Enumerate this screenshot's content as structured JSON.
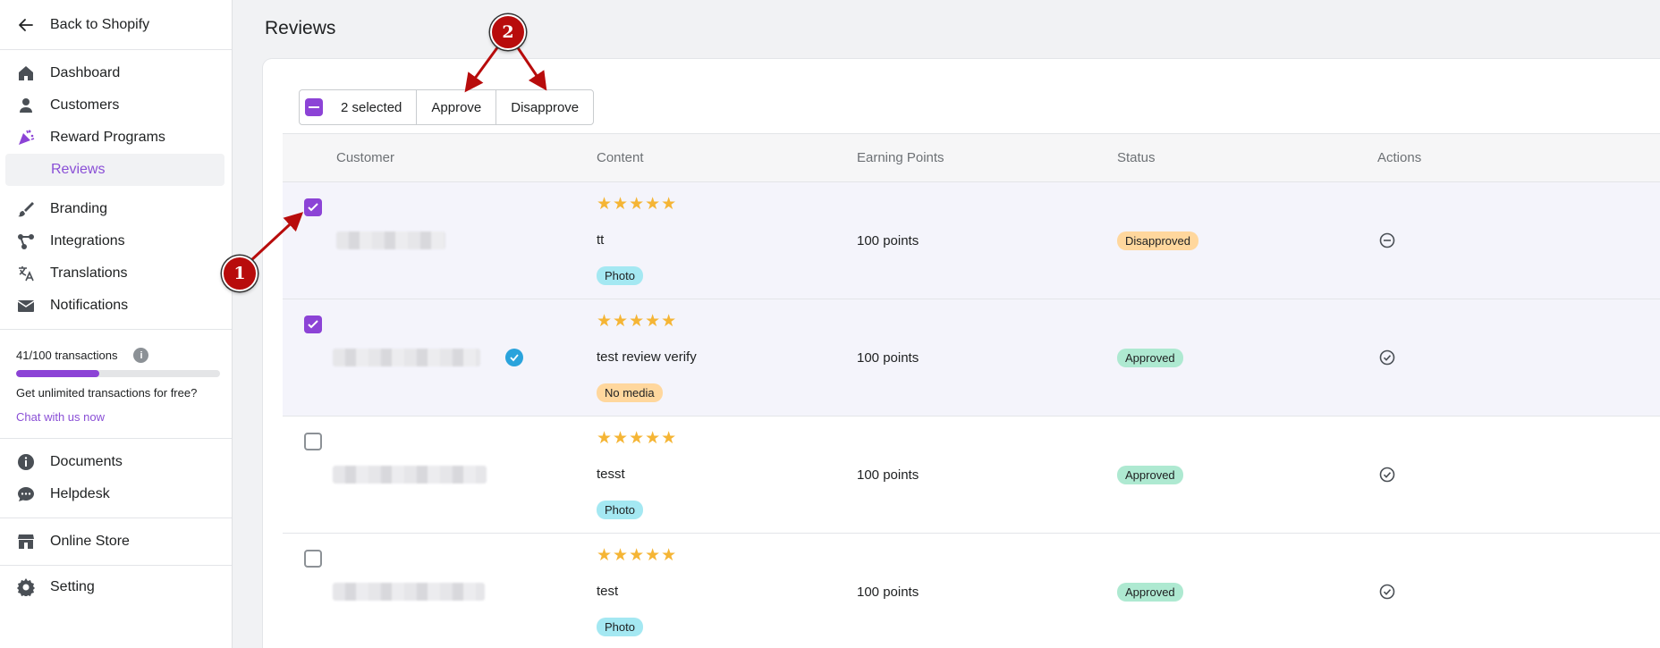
{
  "sidebar": {
    "back_label": "Back to Shopify",
    "nav": [
      {
        "label": "Dashboard",
        "icon": "home-icon"
      },
      {
        "label": "Customers",
        "icon": "user-icon"
      },
      {
        "label": "Reward Programs",
        "icon": "party-popper-icon"
      }
    ],
    "sub_nav": {
      "label": "Reviews"
    },
    "nav2": [
      {
        "label": "Branding",
        "icon": "brush-icon"
      },
      {
        "label": "Integrations",
        "icon": "integration-icon"
      },
      {
        "label": "Translations",
        "icon": "translate-icon"
      },
      {
        "label": "Notifications",
        "icon": "mail-icon"
      }
    ],
    "usage": {
      "label": "41/100 transactions",
      "used": 41,
      "limit": 100,
      "upsell": "Get unlimited transactions for free?",
      "link": "Chat with us now"
    },
    "help": [
      {
        "label": "Documents",
        "icon": "info-icon"
      },
      {
        "label": "Helpdesk",
        "icon": "chat-icon"
      }
    ],
    "store": {
      "label": "Online Store",
      "icon": "store-icon"
    },
    "setting": {
      "label": "Setting",
      "icon": "gear-icon"
    }
  },
  "page": {
    "title": "Reviews"
  },
  "bulk": {
    "selected_label": "2 selected",
    "approve_label": "Approve",
    "disapprove_label": "Disapprove"
  },
  "table": {
    "headers": [
      "Customer",
      "Content",
      "Earning Points",
      "Status",
      "Actions"
    ],
    "rows": [
      {
        "selected": true,
        "stars": "★★★★★",
        "content": "tt",
        "media": "Photo",
        "points": "100 points",
        "status": "Disapproved"
      },
      {
        "selected": true,
        "stars": "★★★★★",
        "content": "test review verify",
        "media": "No media",
        "points": "100 points",
        "status": "Approved"
      },
      {
        "selected": false,
        "stars": "★★★★★",
        "content": "tesst",
        "media": "Photo",
        "points": "100 points",
        "status": "Approved"
      },
      {
        "selected": false,
        "stars": "★★★★★",
        "content": "test",
        "media": "Photo",
        "points": "100 points",
        "status": "Approved"
      }
    ]
  },
  "annotations": {
    "marker1": "1",
    "marker2": "2"
  },
  "colors": {
    "accent": "#8c43d6",
    "annotation": "#b80c0c",
    "star": "#f5b535",
    "approved": "#aee9d1",
    "disapproved": "#ffd79d",
    "photo": "#a4e8f2"
  }
}
